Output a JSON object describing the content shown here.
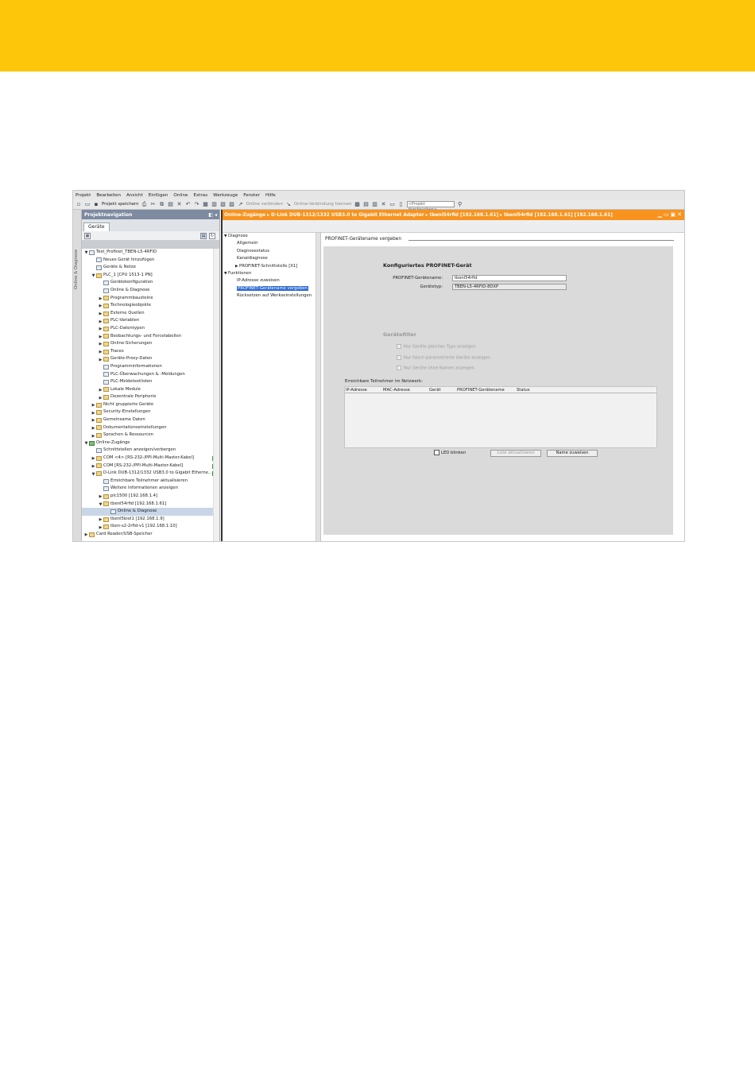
{
  "menu": [
    "Projekt",
    "Bearbeiten",
    "Ansicht",
    "Einfügen",
    "Online",
    "Extras",
    "Werkzeuge",
    "Fenster",
    "Hilfe"
  ],
  "toolbar": {
    "save_label": "Projekt speichern",
    "online_connect": "Online verbinden",
    "online_disconnect": "Online-Verbindung trennen",
    "search_placeholder": "<Projekt durchsuchen>"
  },
  "side_strip": "Online & Diagnose",
  "project_nav": {
    "title": "Projektnavigation",
    "tab": "Geräte",
    "tree": [
      {
        "label": "Test_Profinet_TBEN-L5-4RFID",
        "indent": 0,
        "toggle": "▼",
        "icon": "doc"
      },
      {
        "label": "Neues Gerät hinzufügen",
        "indent": 1,
        "toggle": "",
        "icon": "dev"
      },
      {
        "label": "Geräte & Netze",
        "indent": 1,
        "toggle": "",
        "icon": "dev"
      },
      {
        "label": "PLC_1 [CPU 1513-1 PN]",
        "indent": 1,
        "toggle": "▼",
        "icon": "fld"
      },
      {
        "label": "Gerätekonfiguration",
        "indent": 2,
        "toggle": "",
        "icon": "dev"
      },
      {
        "label": "Online & Diagnose",
        "indent": 2,
        "toggle": "",
        "icon": "dev"
      },
      {
        "label": "Programmbausteine",
        "indent": 2,
        "toggle": "▶",
        "icon": "fld"
      },
      {
        "label": "Technologieobjekte",
        "indent": 2,
        "toggle": "▶",
        "icon": "fld"
      },
      {
        "label": "Externe Quellen",
        "indent": 2,
        "toggle": "▶",
        "icon": "fld"
      },
      {
        "label": "PLC-Variablen",
        "indent": 2,
        "toggle": "▶",
        "icon": "fld"
      },
      {
        "label": "PLC-Datentypen",
        "indent": 2,
        "toggle": "▶",
        "icon": "fld"
      },
      {
        "label": "Beobachtungs- und Forcetabellen",
        "indent": 2,
        "toggle": "▶",
        "icon": "fld"
      },
      {
        "label": "Online-Sicherungen",
        "indent": 2,
        "toggle": "▶",
        "icon": "fld"
      },
      {
        "label": "Traces",
        "indent": 2,
        "toggle": "▶",
        "icon": "fld"
      },
      {
        "label": "Geräte-Proxy-Daten",
        "indent": 2,
        "toggle": "▶",
        "icon": "fld"
      },
      {
        "label": "Programminformationen",
        "indent": 2,
        "toggle": "",
        "icon": "dev"
      },
      {
        "label": "PLC-Überwachungen & -Meldungen",
        "indent": 2,
        "toggle": "",
        "icon": "dev"
      },
      {
        "label": "PLC-Meldetextlisten",
        "indent": 2,
        "toggle": "",
        "icon": "dev"
      },
      {
        "label": "Lokale Module",
        "indent": 2,
        "toggle": "▶",
        "icon": "fld"
      },
      {
        "label": "Dezentrale Peripherie",
        "indent": 2,
        "toggle": "▶",
        "icon": "fld"
      },
      {
        "label": "Nicht gruppierte Geräte",
        "indent": 1,
        "toggle": "▶",
        "icon": "fld"
      },
      {
        "label": "Security-Einstellungen",
        "indent": 1,
        "toggle": "▶",
        "icon": "fld"
      },
      {
        "label": "Gemeinsame Daten",
        "indent": 1,
        "toggle": "▶",
        "icon": "fld"
      },
      {
        "label": "Dokumentationseinstellungen",
        "indent": 1,
        "toggle": "▶",
        "icon": "fld"
      },
      {
        "label": "Sprachen & Ressourcen",
        "indent": 1,
        "toggle": "▶",
        "icon": "fld"
      },
      {
        "label": "Online-Zugänge",
        "indent": 0,
        "toggle": "▼",
        "icon": "grn"
      },
      {
        "label": "Schnittstellen anzeigen/verbergen",
        "indent": 1,
        "toggle": "",
        "icon": "dev"
      },
      {
        "label": "COM <4> [RS-232-/PPI-Multi-Master-Kabel]",
        "indent": 1,
        "toggle": "▶",
        "icon": "fld",
        "flag": true
      },
      {
        "label": "COM [RS-232-/PPI-Multi-Master-Kabel]",
        "indent": 1,
        "toggle": "▶",
        "icon": "fld",
        "flag": true
      },
      {
        "label": "D-Link DUB-1312/1332 USB3.0 to Gigabit Etherne...",
        "indent": 1,
        "toggle": "▼",
        "icon": "fld",
        "flag": true
      },
      {
        "label": "Erreichbare Teilnehmer aktualisieren",
        "indent": 2,
        "toggle": "",
        "icon": "dev"
      },
      {
        "label": "Weitere Informationen anzeigen",
        "indent": 2,
        "toggle": "",
        "icon": "dev"
      },
      {
        "label": "plc1500 [192.168.1.4]",
        "indent": 2,
        "toggle": "▶",
        "icon": "fld"
      },
      {
        "label": "tbenl54rfid [192.168.1.61]",
        "indent": 2,
        "toggle": "▼",
        "icon": "fld"
      },
      {
        "label": "Online & Diagnose",
        "indent": 3,
        "toggle": "",
        "icon": "dev",
        "selected": true
      },
      {
        "label": "tbenl5biol1 [192.168.1.9]",
        "indent": 2,
        "toggle": "▶",
        "icon": "fld"
      },
      {
        "label": "tben-s2-2rfid-v1 [192.168.1.10]",
        "indent": 2,
        "toggle": "▶",
        "icon": "fld"
      },
      {
        "label": "Card Reader/USB-Speicher",
        "indent": 0,
        "toggle": "▶",
        "icon": "fld"
      }
    ]
  },
  "main": {
    "breadcrumb": "Online-Zugänge  ▸  D-Link DUB-1312/1332 USB3.0 to Gigabit Ethernet Adapter  ▸  tbenl54rfid [192.168.1.61]  ▸  tbenl54rfid [192.168.1.61] [192.168.1.61]",
    "diag_nav": [
      {
        "label": "Diagnose",
        "indent": 0,
        "toggle": "▼"
      },
      {
        "label": "Allgemein",
        "indent": 1,
        "toggle": ""
      },
      {
        "label": "Diagnosestatus",
        "indent": 1,
        "toggle": ""
      },
      {
        "label": "Kanaldiagnose",
        "indent": 1,
        "toggle": ""
      },
      {
        "label": "PROFINET-Schnittstelle [X1]",
        "indent": 1,
        "toggle": "▶"
      },
      {
        "label": "Funktionen",
        "indent": 0,
        "toggle": "▼"
      },
      {
        "label": "IP-Adresse zuweisen",
        "indent": 1,
        "toggle": ""
      },
      {
        "label": "PROFINET-Gerätename vergeben",
        "indent": 1,
        "toggle": "",
        "selected": true
      },
      {
        "label": "Rücksetzen auf Werkseinstellungen",
        "indent": 1,
        "toggle": ""
      }
    ],
    "section_title": "PROFINET-Gerätename vergeben",
    "configured_title": "Konfiguriertes PROFINET-Gerät",
    "device_name_label": "PROFINET-Gerätename:",
    "device_name_value": "tbenl54rfid",
    "device_type_label": "Gerätetyp:",
    "device_type_value": "TBEN-L5-4RFID-8DXP",
    "filter_title": "Gerätefilter",
    "filter_options": [
      "Nur Geräte gleichen Typs anzeigen",
      "Nur falsch parametrierte Geräte anzeigen",
      "Nur Geräte ohne Namen anzeigen"
    ],
    "reachable_label": "Erreichbare Teilnehmer im Netzwerk:",
    "table_columns": [
      "IP-Adresse",
      "MAC-Adresse",
      "Gerät",
      "PROFINET-Gerätename",
      "Status"
    ],
    "led_label": "LED blinken",
    "refresh_button": "Liste aktualisieren",
    "assign_button": "Name zuweisen"
  }
}
